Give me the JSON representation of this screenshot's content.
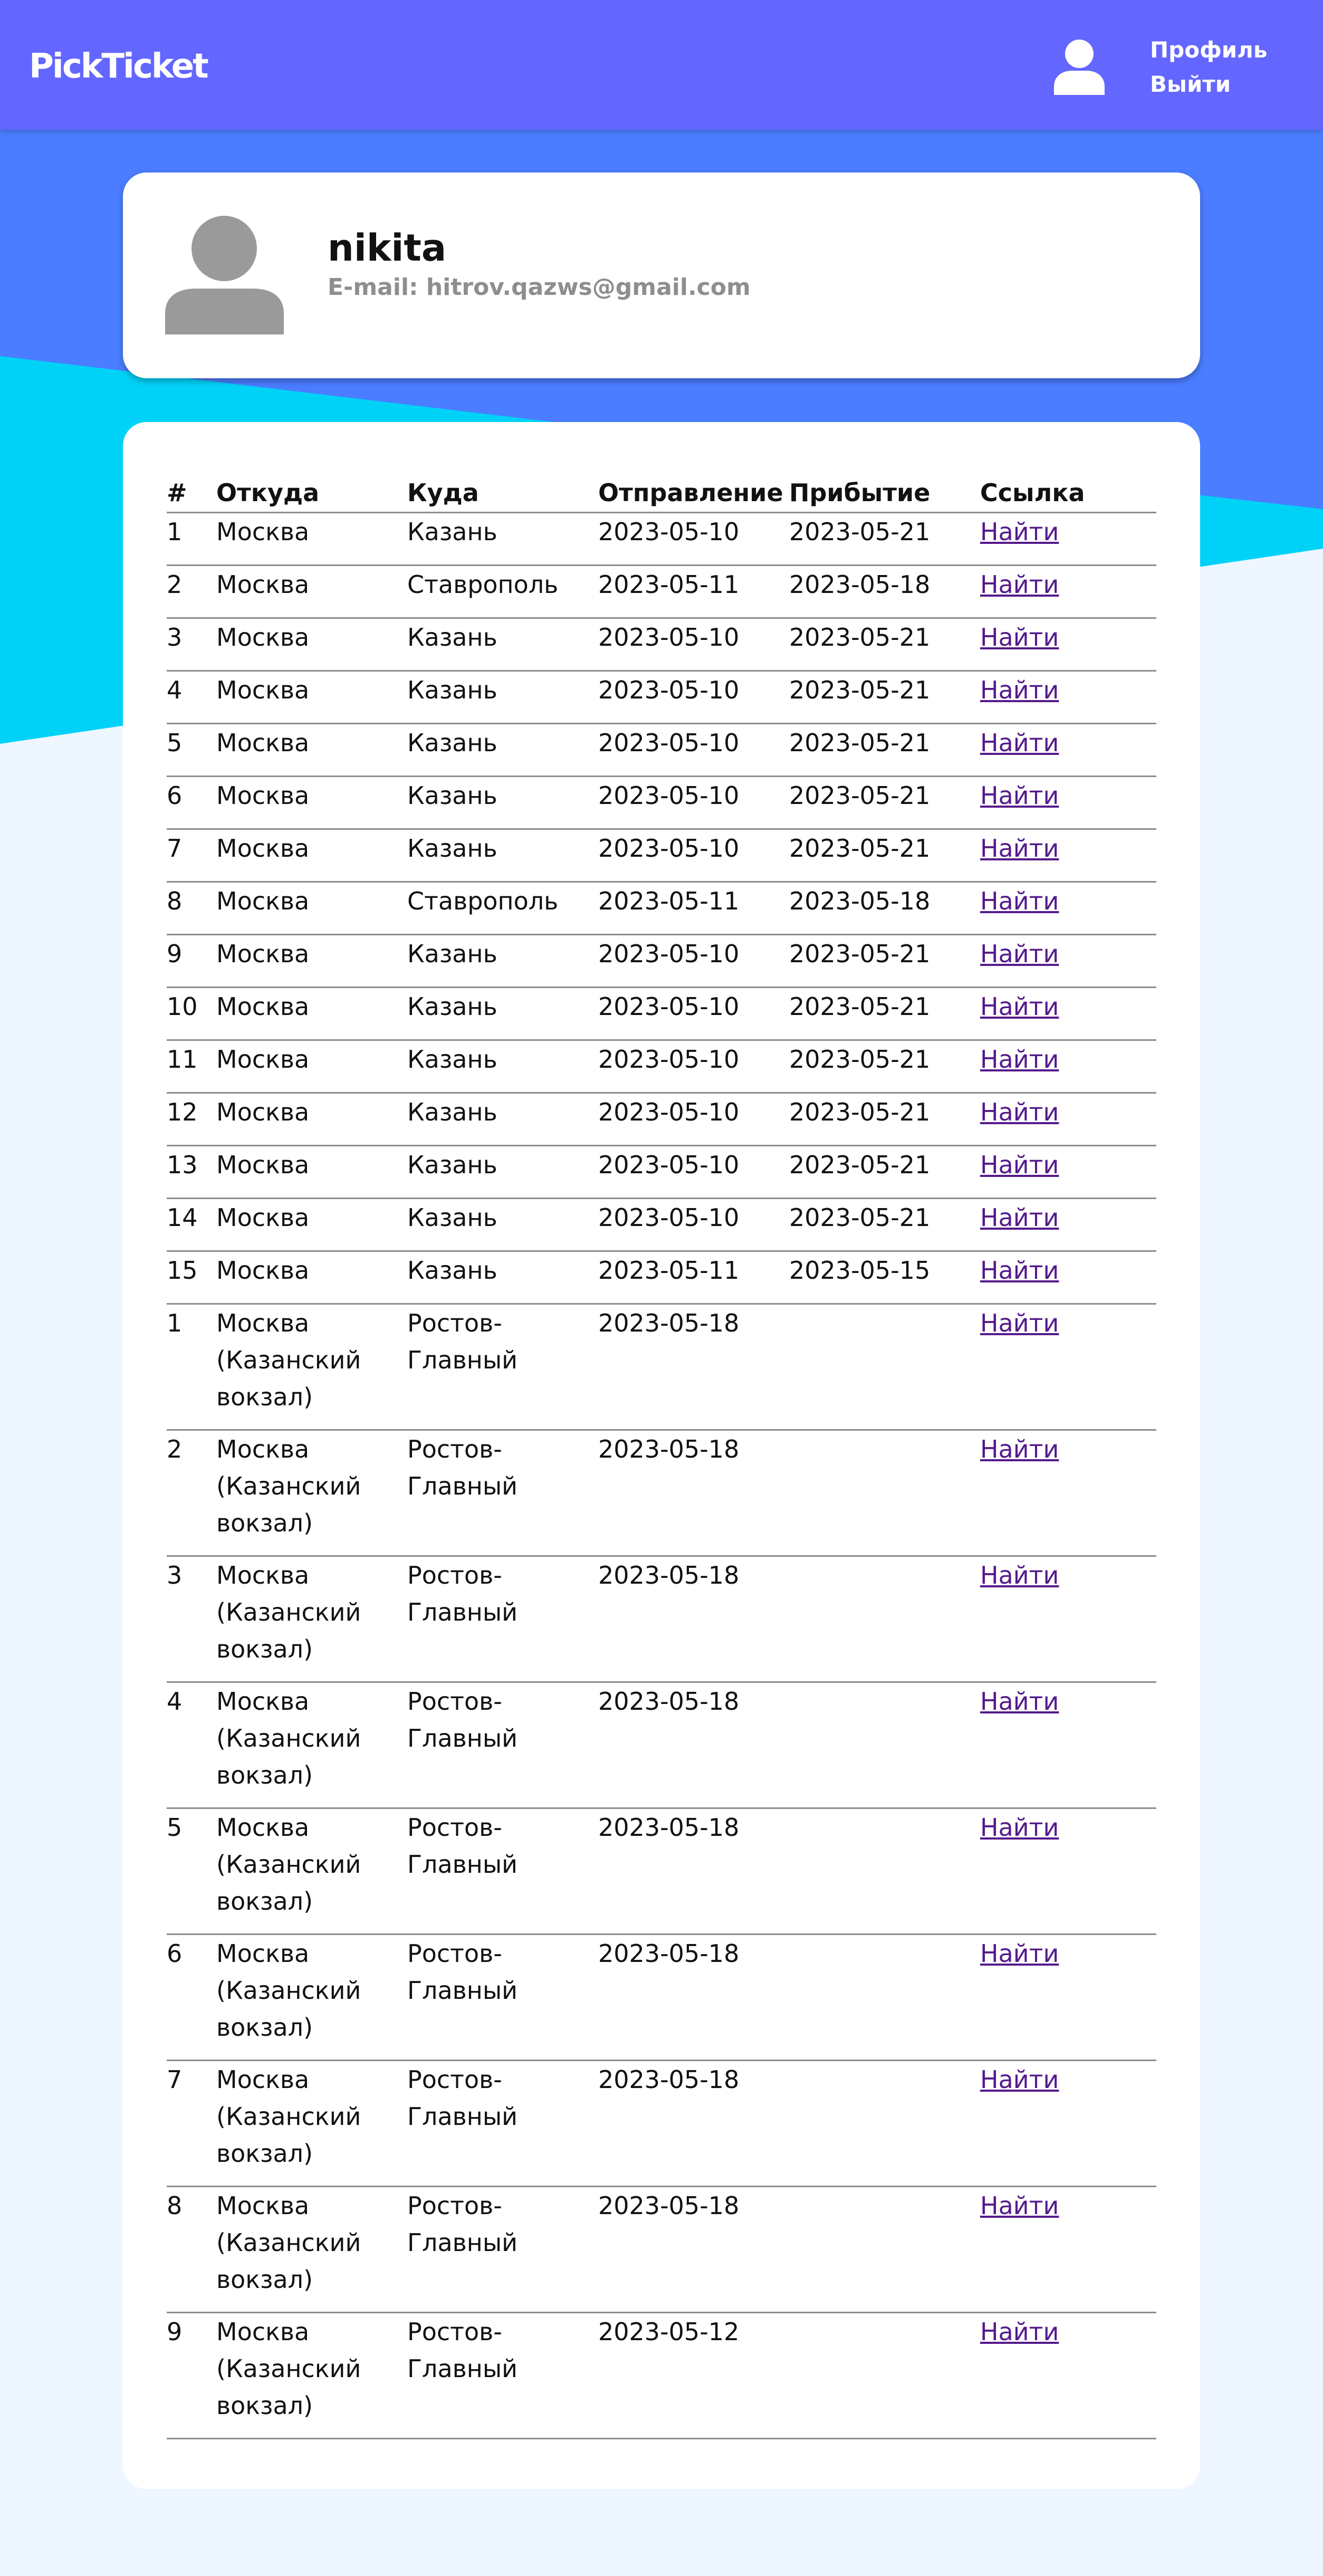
{
  "app": {
    "logo": "PickTicket",
    "nav": {
      "profile_label": "Профиль",
      "logout_label": "Выйти"
    }
  },
  "colors": {
    "header": "#6366ff",
    "background_blue": "#4a7dff",
    "background_cyan": "#00d2f7",
    "background_light": "#eef6ff",
    "link": "#551a8b",
    "muted_text": "#8e8e8e"
  },
  "profile": {
    "name": "nikita",
    "email": "E-mail: hitrov.qazws@gmail.com"
  },
  "table": {
    "headers": [
      "#",
      "Откуда",
      "Куда",
      "Отправление",
      "Прибытие",
      "Ссылка"
    ],
    "rows": [
      {
        "num": "1",
        "from": "Москва",
        "to": "Казань",
        "departure": "2023-05-10",
        "arrival": "2023-05-21",
        "link": "Найти"
      },
      {
        "num": "2",
        "from": "Москва",
        "to": "Ставрополь",
        "departure": "2023-05-11",
        "arrival": "2023-05-18",
        "link": "Найти"
      },
      {
        "num": "3",
        "from": "Москва",
        "to": "Казань",
        "departure": "2023-05-10",
        "arrival": "2023-05-21",
        "link": "Найти"
      },
      {
        "num": "4",
        "from": "Москва",
        "to": "Казань",
        "departure": "2023-05-10",
        "arrival": "2023-05-21",
        "link": "Найти"
      },
      {
        "num": "5",
        "from": "Москва",
        "to": "Казань",
        "departure": "2023-05-10",
        "arrival": "2023-05-21",
        "link": "Найти"
      },
      {
        "num": "6",
        "from": "Москва",
        "to": "Казань",
        "departure": "2023-05-10",
        "arrival": "2023-05-21",
        "link": "Найти"
      },
      {
        "num": "7",
        "from": "Москва",
        "to": "Казань",
        "departure": "2023-05-10",
        "arrival": "2023-05-21",
        "link": "Найти"
      },
      {
        "num": "8",
        "from": "Москва",
        "to": "Ставрополь",
        "departure": "2023-05-11",
        "arrival": "2023-05-18",
        "link": "Найти"
      },
      {
        "num": "9",
        "from": "Москва",
        "to": "Казань",
        "departure": "2023-05-10",
        "arrival": "2023-05-21",
        "link": "Найти"
      },
      {
        "num": "10",
        "from": "Москва",
        "to": "Казань",
        "departure": "2023-05-10",
        "arrival": "2023-05-21",
        "link": "Найти"
      },
      {
        "num": "11",
        "from": "Москва",
        "to": "Казань",
        "departure": "2023-05-10",
        "arrival": "2023-05-21",
        "link": "Найти"
      },
      {
        "num": "12",
        "from": "Москва",
        "to": "Казань",
        "departure": "2023-05-10",
        "arrival": "2023-05-21",
        "link": "Найти"
      },
      {
        "num": "13",
        "from": "Москва",
        "to": "Казань",
        "departure": "2023-05-10",
        "arrival": "2023-05-21",
        "link": "Найти"
      },
      {
        "num": "14",
        "from": "Москва",
        "to": "Казань",
        "departure": "2023-05-10",
        "arrival": "2023-05-21",
        "link": "Найти"
      },
      {
        "num": "15",
        "from": "Москва",
        "to": "Казань",
        "departure": "2023-05-11",
        "arrival": "2023-05-15",
        "link": "Найти"
      },
      {
        "num": "1",
        "from": "Москва (Казанский вокзал)",
        "to": "Ростов-Главный",
        "departure": "2023-05-18",
        "arrival": "",
        "link": "Найти"
      },
      {
        "num": "2",
        "from": "Москва (Казанский вокзал)",
        "to": "Ростов-Главный",
        "departure": "2023-05-18",
        "arrival": "",
        "link": "Найти"
      },
      {
        "num": "3",
        "from": "Москва (Казанский вокзал)",
        "to": "Ростов-Главный",
        "departure": "2023-05-18",
        "arrival": "",
        "link": "Найти"
      },
      {
        "num": "4",
        "from": "Москва (Казанский вокзал)",
        "to": "Ростов-Главный",
        "departure": "2023-05-18",
        "arrival": "",
        "link": "Найти"
      },
      {
        "num": "5",
        "from": "Москва (Казанский вокзал)",
        "to": "Ростов-Главный",
        "departure": "2023-05-18",
        "arrival": "",
        "link": "Найти"
      },
      {
        "num": "6",
        "from": "Москва (Казанский вокзал)",
        "to": "Ростов-Главный",
        "departure": "2023-05-18",
        "arrival": "",
        "link": "Найти"
      },
      {
        "num": "7",
        "from": "Москва (Казанский вокзал)",
        "to": "Ростов-Главный",
        "departure": "2023-05-18",
        "arrival": "",
        "link": "Найти"
      },
      {
        "num": "8",
        "from": "Москва (Казанский вокзал)",
        "to": "Ростов-Главный",
        "departure": "2023-05-18",
        "arrival": "",
        "link": "Найти"
      },
      {
        "num": "9",
        "from": "Москва (Казанский вокзал)",
        "to": "Ростов-Главный",
        "departure": "2023-05-12",
        "arrival": "",
        "link": "Найти"
      }
    ]
  }
}
